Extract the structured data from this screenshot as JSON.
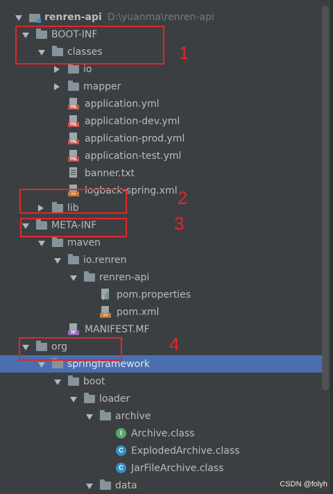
{
  "tree": {
    "root": {
      "name": "renren-api",
      "path": "D:\\yuanma\\renren-api"
    },
    "items": [
      {
        "label": "BOOT-INF",
        "kind": "folder",
        "expanded": true
      },
      {
        "label": "classes",
        "kind": "folder",
        "expanded": true
      },
      {
        "label": "io",
        "kind": "folder",
        "expanded": false
      },
      {
        "label": "mapper",
        "kind": "folder",
        "expanded": false
      },
      {
        "label": "application.yml",
        "kind": "yml"
      },
      {
        "label": "application-dev.yml",
        "kind": "yml"
      },
      {
        "label": "application-prod.yml",
        "kind": "yml"
      },
      {
        "label": "application-test.yml",
        "kind": "yml"
      },
      {
        "label": "banner.txt",
        "kind": "txt"
      },
      {
        "label": "logback-spring.xml",
        "kind": "xml"
      },
      {
        "label": "lib",
        "kind": "folder",
        "expanded": false
      },
      {
        "label": "META-INF",
        "kind": "folder",
        "expanded": true
      },
      {
        "label": "maven",
        "kind": "folder",
        "expanded": true
      },
      {
        "label": "io.renren",
        "kind": "folder",
        "expanded": true
      },
      {
        "label": "renren-api",
        "kind": "folder",
        "expanded": true
      },
      {
        "label": "pom.properties",
        "kind": "properties"
      },
      {
        "label": "pom.xml",
        "kind": "xml"
      },
      {
        "label": "MANIFEST.MF",
        "kind": "mf"
      },
      {
        "label": "org",
        "kind": "folder",
        "expanded": true
      },
      {
        "label": "springframework",
        "kind": "folder",
        "expanded": true,
        "selected": true
      },
      {
        "label": "boot",
        "kind": "folder",
        "expanded": true
      },
      {
        "label": "loader",
        "kind": "folder",
        "expanded": true
      },
      {
        "label": "archive",
        "kind": "folder",
        "expanded": true
      },
      {
        "label": "Archive.class",
        "kind": "interface"
      },
      {
        "label": "ExplodedArchive.class",
        "kind": "class"
      },
      {
        "label": "JarFileArchive.class",
        "kind": "class"
      },
      {
        "label": "data",
        "kind": "folder",
        "expanded": true
      }
    ],
    "icon_tags": {
      "yml": "YML",
      "xml": "<>",
      "mf": "MF",
      "interface": "I",
      "class": "C"
    }
  },
  "annotations": [
    {
      "number": "1"
    },
    {
      "number": "2"
    },
    {
      "number": "3"
    },
    {
      "number": "4"
    }
  ],
  "watermark": "CSDN @folyh",
  "colors": {
    "background": "#3c3f41",
    "selection": "#4b6eaf",
    "annotation": "#e3262b",
    "folder": "#87939a"
  }
}
